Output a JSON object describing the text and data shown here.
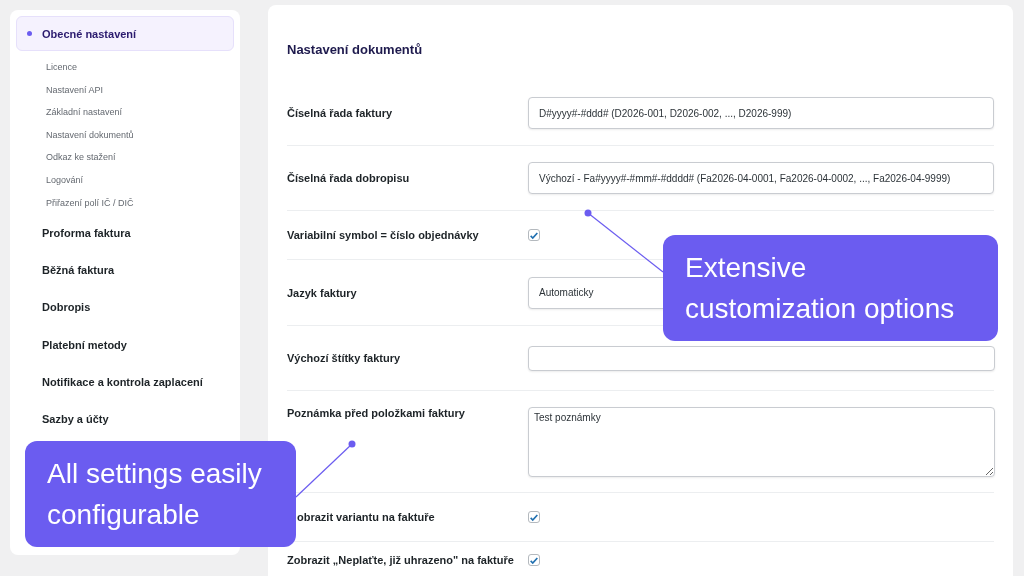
{
  "sidebar": {
    "items": [
      {
        "label": "Obecné nastavení",
        "selected": true,
        "children": [
          {
            "label": "Licence",
            "selected": false
          },
          {
            "label": "Nastavení API",
            "selected": false
          },
          {
            "label": "Základní nastavení",
            "selected": false
          },
          {
            "label": "Nastavení dokumentů",
            "selected": false
          },
          {
            "label": "Odkaz ke stažení",
            "selected": false
          },
          {
            "label": "Logování",
            "selected": false
          },
          {
            "label": "Přiřazení polí IČ / DIČ",
            "selected": false
          }
        ]
      },
      {
        "label": "Proforma faktura",
        "selected": false
      },
      {
        "label": "Běžná faktura",
        "selected": false
      },
      {
        "label": "Dobropis",
        "selected": false
      },
      {
        "label": "Platební metody",
        "selected": false
      },
      {
        "label": "Notifikace a kontrola zaplacení",
        "selected": false
      },
      {
        "label": "Sazby a účty",
        "selected": false
      }
    ]
  },
  "section": {
    "title": "Nastavení dokumentů",
    "fields": [
      {
        "kind": "text",
        "label": "Číselná řada faktury",
        "value": "D#yyyy#-#ddd# (D2026-001, D2026-002, ..., D2026-999)"
      },
      {
        "kind": "text",
        "label": "Číselná řada dobropisu",
        "value": "Výchozí - Fa#yyyy#-#mm#-#dddd# (Fa2026-04-0001, Fa2026-04-0002, ..., Fa2026-04-9999)"
      },
      {
        "kind": "checkbox",
        "label": "Variabilní symbol = číslo objednávky",
        "checked": true
      },
      {
        "kind": "select",
        "label": "Jazyk faktury",
        "value": "Automaticky"
      },
      {
        "kind": "text",
        "label": "Výchozí štítky faktury"
      },
      {
        "kind": "textarea",
        "label": "Poznámka před položkami faktury",
        "value": "Test poznámky"
      },
      {
        "kind": "checkbox",
        "label": "obrazit variantu na faktuře",
        "checked": true,
        "covered": true
      },
      {
        "kind": "checkbox",
        "label": "Zobrazit „Neplaťte, již uhrazeno\" na faktuře",
        "checked": true
      }
    ]
  },
  "callouts": [
    {
      "text": "Extensive customization options"
    },
    {
      "text": "All settings easily configurable"
    }
  ]
}
